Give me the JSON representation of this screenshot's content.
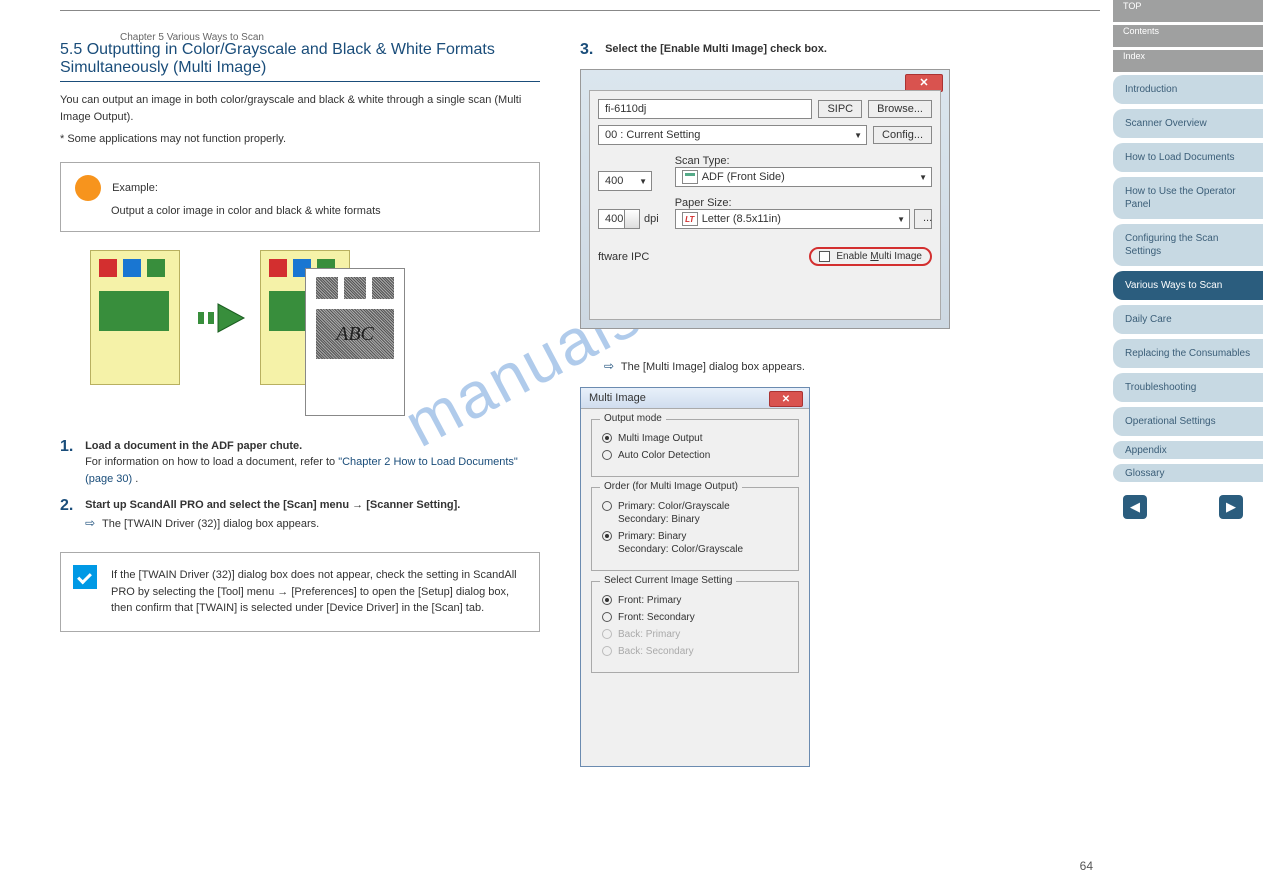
{
  "chapter_header": "Chapter 5 Various Ways to Scan",
  "section_title": "5.5 Outputting in Color/Grayscale and Black & White Formats Simultaneously (Multi Image)",
  "intro": "You can output an image in both color/grayscale and black & white through a single scan (Multi Image Output).",
  "note_star": "* Some applications may not function properly.",
  "example_label": "Example:",
  "example_desc_1": "Output a color image in color and black & white formats",
  "diagram_abc": "ABC",
  "step1": {
    "num": "1.",
    "text": "Load a document in the ADF paper chute.",
    "ref_pre": "For information on how to load a document, refer to ",
    "ref": "\"Chapter 2 How to Load Documents\" (page 30)",
    "ref_post": "."
  },
  "step2": {
    "num": "2.",
    "text": "Start up ScandAll PRO and select the [Scan] menu → [Scanner Setting].",
    "result": "The [TWAIN Driver (32)] dialog box appears."
  },
  "hint": "If the [TWAIN Driver (32)] dialog box does not appear, check the setting in ScandAll PRO by selecting the [Tool] menu → [Preferences] to open the [Setup] dialog box, then confirm that [TWAIN] is selected under [Device Driver] in the [Scan] tab.",
  "step3": {
    "num": "3.",
    "text": "Select the [Enable Multi Image] check box.",
    "result": "The [Multi Image] dialog box appears."
  },
  "ss1": {
    "scanner": "fi-6110dj",
    "sipc": "SIPC",
    "browse": "Browse...",
    "setting": "00 : Current Setting",
    "config": "Config...",
    "res_dd": "400",
    "dpi_spin": "400",
    "dpi_lbl": "dpi",
    "scan_type_lbl": "Scan Type:",
    "scan_type_val": "ADF (Front Side)",
    "paper_lbl": "Paper Size:",
    "paper_val": "Letter (8.5x11in)",
    "ipc": "ftware IPC",
    "enable": "Enable Multi Image",
    "lt": "LT"
  },
  "ss2": {
    "title": "Multi Image",
    "grp1": "Output mode",
    "r1": "Multi Image Output",
    "r2": "Auto Color Detection",
    "grp2": "Order (for Multi Image Output)",
    "r3a": "Primary: Color/Grayscale",
    "r3b": "Secondary: Binary",
    "r4a": "Primary: Binary",
    "r4b": "Secondary: Color/Grayscale",
    "grp3": "Select Current Image Setting",
    "r5": "Front: Primary",
    "r6": "Front: Secondary",
    "r7": "Back: Primary",
    "r8": "Back: Secondary"
  },
  "sidebar": {
    "top": "TOP",
    "contents": "Contents",
    "index": "Index",
    "items": [
      "Introduction",
      "Scanner Overview",
      "How to Load Documents",
      "How to Use the Operator Panel",
      "Configuring the Scan Settings",
      "Various Ways to Scan",
      "Daily Care",
      "Replacing the Consumables",
      "Troubleshooting",
      "Operational Settings"
    ],
    "appendix": "Appendix",
    "glossary": "Glossary"
  },
  "page_number": "64",
  "watermark": "manualshive.com"
}
